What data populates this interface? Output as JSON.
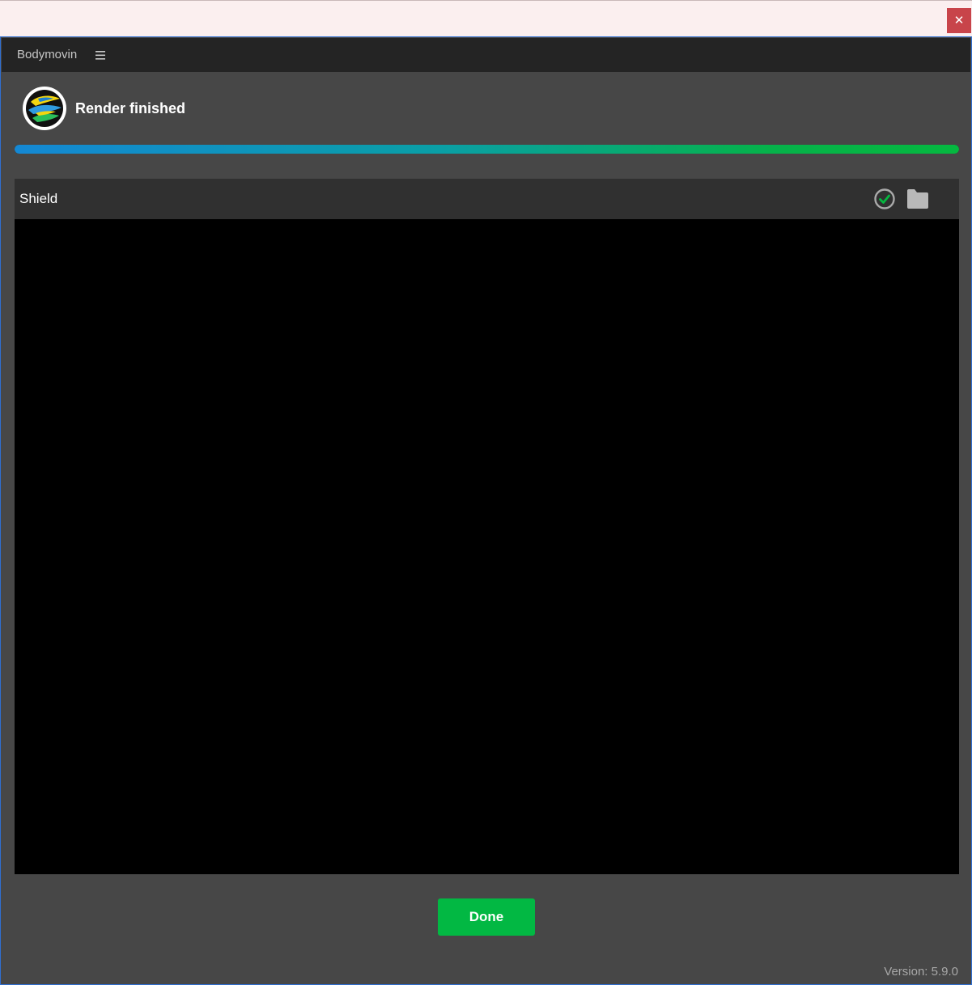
{
  "window": {
    "close_glyph": "✕"
  },
  "panel": {
    "title": "Bodymovin",
    "menu_icon": "hamburger-menu-icon"
  },
  "status": {
    "text": "Render finished",
    "progress_percent": 100
  },
  "composition": {
    "name": "Shield",
    "state_icon": "check-circle-icon",
    "action_icon": "folder-icon"
  },
  "actions": {
    "done_label": "Done"
  },
  "footer": {
    "version": "Version: 5.9.0"
  },
  "colors": {
    "accent_green": "#02b843",
    "progress_start": "#1488d4",
    "progress_end": "#05b840",
    "panel_bg": "#474747",
    "header_bg": "#242424",
    "close_red": "#c8444a"
  }
}
